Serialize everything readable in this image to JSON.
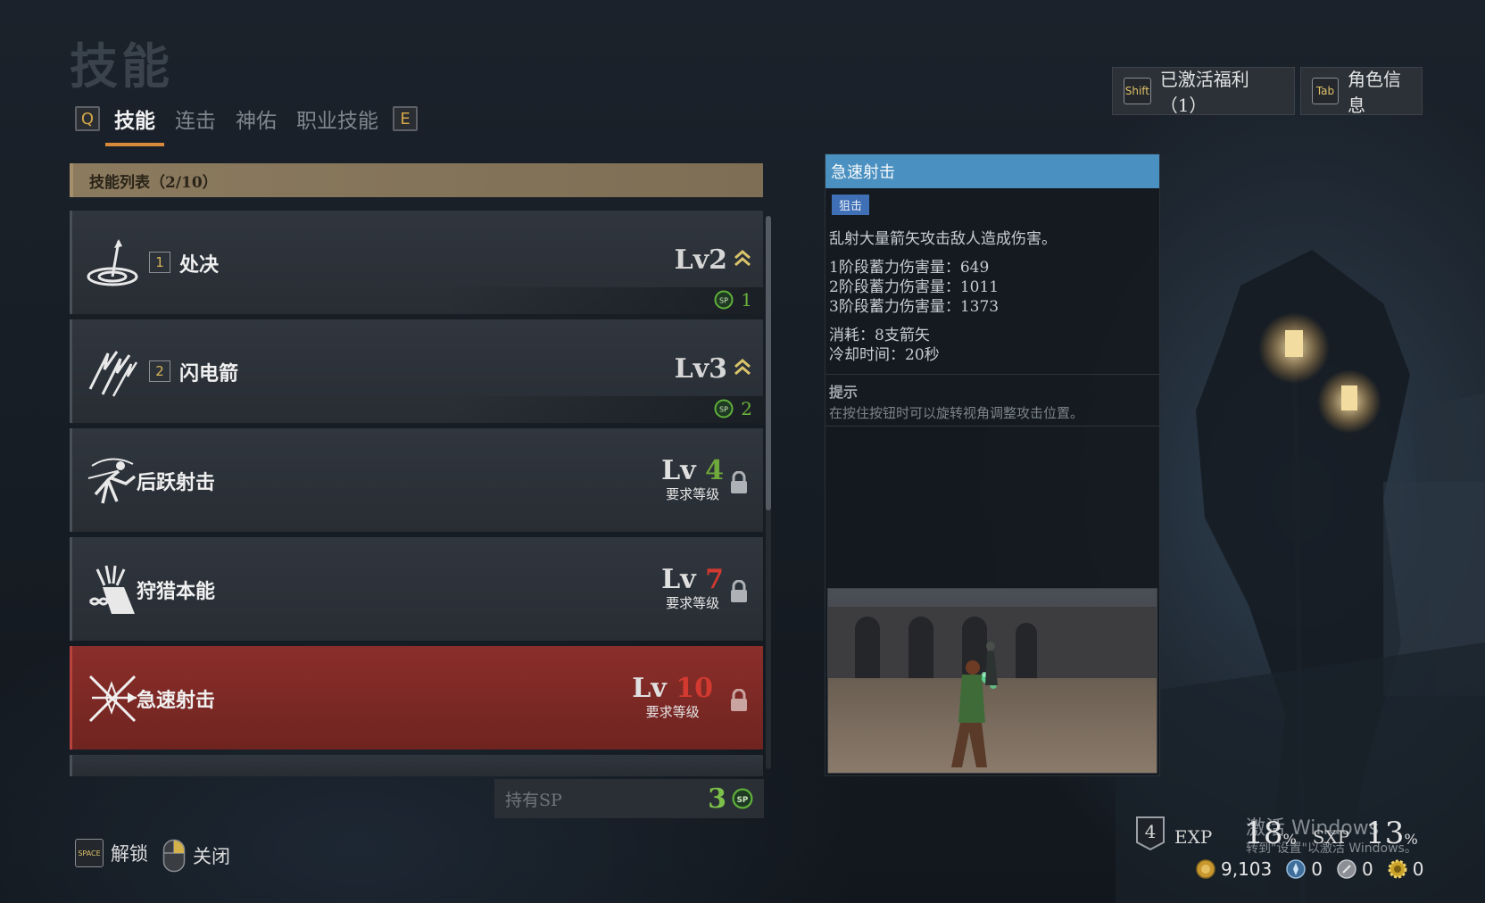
{
  "page": {
    "title": "技能"
  },
  "tabs": {
    "prev_key": "Q",
    "next_key": "E",
    "items": [
      "技能",
      "连击",
      "神佑",
      "职业技能"
    ]
  },
  "top_buttons": {
    "perks": {
      "key": "Shift",
      "label": "已激活福利（1）"
    },
    "character": {
      "key": "Tab",
      "label": "角色信息"
    }
  },
  "skill_list": {
    "header": "技能列表（2/10）",
    "skills": [
      {
        "slot": "1",
        "name": "处决",
        "level": "Lv2",
        "sp_cost": "1"
      },
      {
        "slot": "2",
        "name": "闪电箭",
        "level": "Lv3",
        "sp_cost": "2"
      },
      {
        "name": "后跃射击",
        "lv_prefix": "Lv",
        "req_level": "4",
        "req_label": "要求等级",
        "req_color": "#6fa83a"
      },
      {
        "name": "狩猎本能",
        "lv_prefix": "Lv",
        "req_level": "7",
        "req_label": "要求等级",
        "req_color": "#d23a30"
      },
      {
        "name": "急速射击",
        "lv_prefix": "Lv",
        "req_level": "10",
        "req_label": "要求等级",
        "req_color": "#d23a30"
      }
    ]
  },
  "sp_holder": {
    "label": "持有SP",
    "value": "3",
    "badge": "SP"
  },
  "footer": {
    "unlock": {
      "key": "SPACE",
      "label": "解锁"
    },
    "close": {
      "label": "关闭"
    }
  },
  "detail": {
    "title": "急速射击",
    "tag": "狙击",
    "description": "乱射大量箭矢攻击敌人造成伤害。",
    "stats": [
      "1阶段蓄力伤害量：649",
      "2阶段蓄力伤害量：1011",
      "3阶段蓄力伤害量：1373"
    ],
    "cost": "消耗：8支箭矢",
    "cooldown": "冷却时间：20秒",
    "tip_title": "提示",
    "tip_text": "在按住按钮时可以旋转视角调整攻击位置。"
  },
  "status": {
    "level": "4",
    "exp_label": "EXP",
    "exp_value": "18",
    "exp_unit": "%",
    "sxp_label": "SXP",
    "sxp_value": "13",
    "sxp_unit": "%",
    "gold": "9,103",
    "currency2": "0",
    "currency3": "0",
    "currency4": "0"
  },
  "watermark": {
    "line1": "激活 Windows",
    "line2": "转到\"设置\"以激活 Windows。"
  },
  "colors": {
    "accent": "#d88a3a",
    "selected_row": "#8b2e2a",
    "detail_title": "#4a90c0",
    "sp_green": "#6bb43a",
    "req_red": "#d23a30"
  }
}
